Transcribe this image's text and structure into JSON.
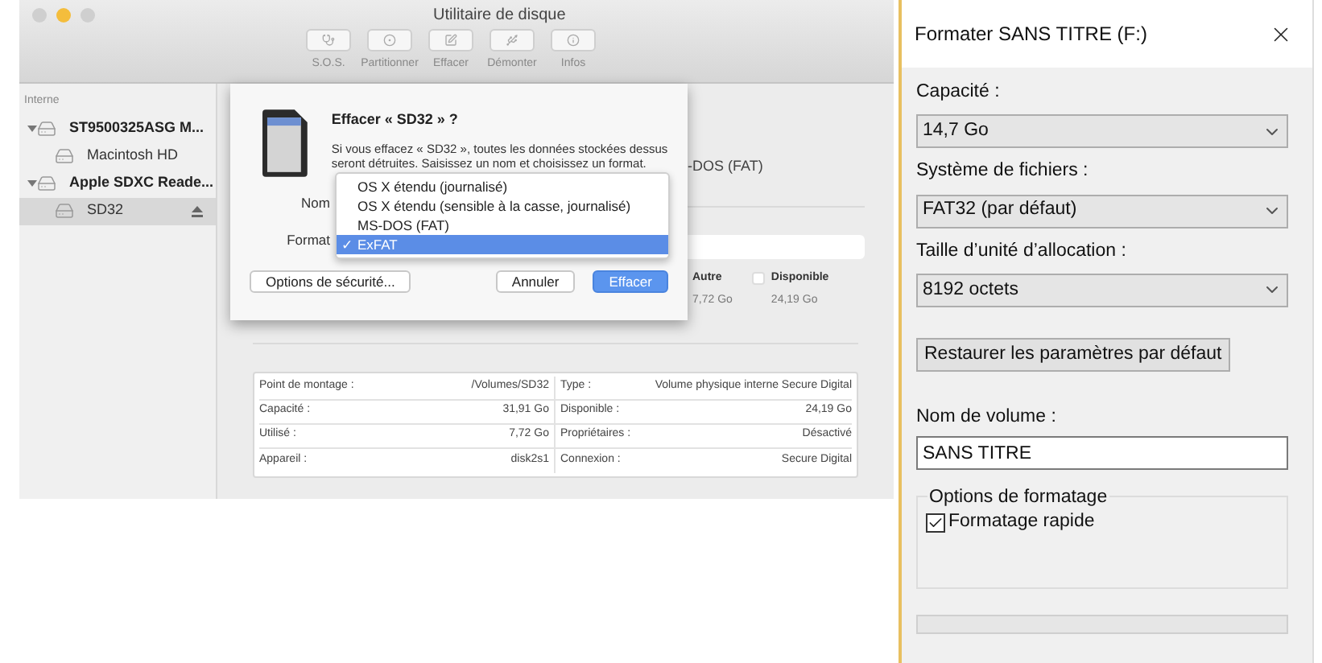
{
  "disk_utility": {
    "title": "Utilitaire de disque",
    "toolbar": [
      {
        "label": "S.O.S.",
        "kind": "sos"
      },
      {
        "label": "Partitionner",
        "kind": "partition"
      },
      {
        "label": "Effacer",
        "kind": "erase"
      },
      {
        "label": "Démonter",
        "kind": "unmount"
      },
      {
        "label": "Infos",
        "kind": "info"
      }
    ],
    "sidebar": {
      "section": "Interne",
      "items": [
        {
          "label": "ST9500325ASG M...",
          "expanded": true,
          "selected": false,
          "children": [
            {
              "label": "Macintosh HD",
              "selected": false,
              "eject": false
            }
          ]
        },
        {
          "label": "Apple SDXC Reade...",
          "expanded": true,
          "selected": false,
          "children": [
            {
              "label": "SD32",
              "selected": true,
              "eject": true
            }
          ]
        }
      ]
    },
    "volume_format": "-DOS (FAT)",
    "usage_legend": [
      {
        "label": "Autre",
        "value": "7,72 Go",
        "swatch": false
      },
      {
        "label": "Disponible",
        "value": "24,19 Go",
        "swatch": true
      }
    ],
    "info_table": [
      {
        "cells": [
          "Point de montage :",
          "/Volumes/SD32",
          "Type :",
          "Volume physique interne Secure Digital"
        ]
      },
      {
        "cells": [
          "Capacité :",
          "31,91 Go",
          "Disponible :",
          "24,19 Go"
        ]
      },
      {
        "cells": [
          "Utilisé :",
          "7,72 Go",
          "Propriétaires :",
          "Désactivé"
        ]
      },
      {
        "cells": [
          "Appareil :",
          "disk2s1",
          "Connexion :",
          "Secure Digital"
        ]
      }
    ],
    "erase_sheet": {
      "title": "Effacer « SD32 » ?",
      "message": "Si vous effacez « SD32 », toutes les données stockées dessus seront détruites. Saisissez un nom et choisissez un format.",
      "name_label": "Nom",
      "format_label": "Format",
      "buttons": [
        {
          "label": "Options de sécurité...",
          "kind": "plain"
        },
        {
          "label": "Annuler",
          "kind": "plain"
        },
        {
          "label": "Effacer",
          "kind": "default"
        }
      ],
      "format_menu": [
        {
          "label": "OS X étendu (journalisé)",
          "selected": false
        },
        {
          "label": "OS X étendu (sensible à la casse, journalisé)",
          "selected": false
        },
        {
          "label": "MS-DOS (FAT)",
          "selected": false
        },
        {
          "label": "ExFAT",
          "selected": true,
          "check": "✓"
        }
      ]
    }
  },
  "format_dialog": {
    "title": "Formater SANS TITRE (F:)",
    "selects": [
      {
        "label": "Capacité :",
        "value": "14,7 Go"
      },
      {
        "label": "Système de fichiers :",
        "value": "FAT32 (par défaut)"
      },
      {
        "label": "Taille d’unité d’allocation :",
        "value": "8192 octets"
      }
    ],
    "restore_button": "Restaurer les paramètres par défaut",
    "volume_label": "Nom de volume :",
    "volume_value": "SANS TITRE",
    "options_group": "Options de formatage",
    "quick_format": {
      "label": "Formatage rapide",
      "checked": true
    },
    "progress": {
      "level": 0
    }
  }
}
